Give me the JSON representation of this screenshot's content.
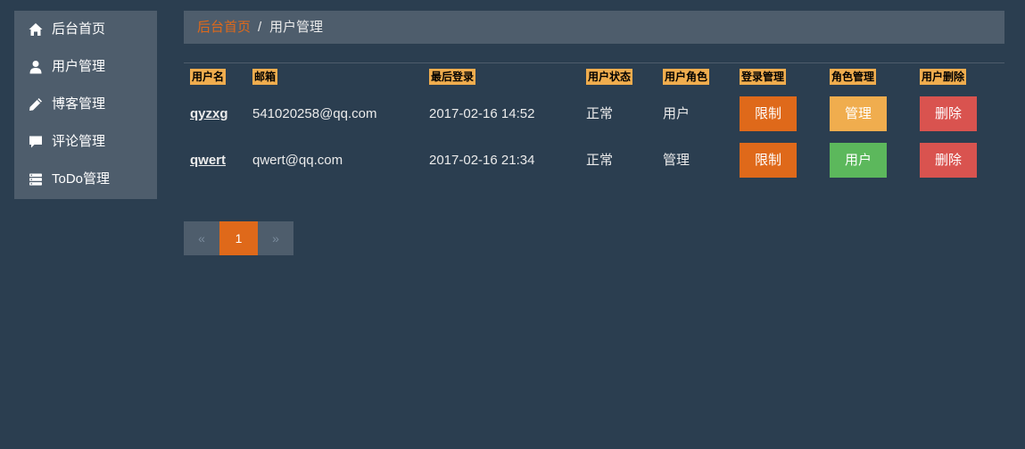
{
  "sidebar": {
    "items": [
      {
        "label": "后台首页",
        "icon": "home-icon"
      },
      {
        "label": "用户管理",
        "icon": "user-icon"
      },
      {
        "label": "博客管理",
        "icon": "pencil-icon"
      },
      {
        "label": "评论管理",
        "icon": "comment-icon"
      },
      {
        "label": "ToDo管理",
        "icon": "tasks-icon"
      }
    ]
  },
  "breadcrumb": {
    "home": "后台首页",
    "separator": "/",
    "current": "用户管理"
  },
  "table": {
    "headers": [
      "用户名",
      "邮箱",
      "最后登录",
      "用户状态",
      "用户角色",
      "登录管理",
      "角色管理",
      "用户删除"
    ],
    "rows": [
      {
        "username": "qyzxg",
        "email": "541020258@qq.com",
        "last_login": "2017-02-16 14:52",
        "status": "正常",
        "role": "用户",
        "login_action": "限制",
        "role_action": "管理",
        "delete_action": "删除"
      },
      {
        "username": "qwert",
        "email": "qwert@qq.com",
        "last_login": "2017-02-16 21:34",
        "status": "正常",
        "role": "管理",
        "login_action": "限制",
        "role_action": "用户",
        "delete_action": "删除"
      }
    ]
  },
  "pagination": {
    "prev": "«",
    "current": "1",
    "next": "»"
  },
  "colors": {
    "background": "#2b3e50",
    "panel": "#4e5d6c",
    "accent": "#df691a",
    "warning": "#f0ad4e",
    "success": "#5cb85c",
    "danger": "#d9534f"
  }
}
